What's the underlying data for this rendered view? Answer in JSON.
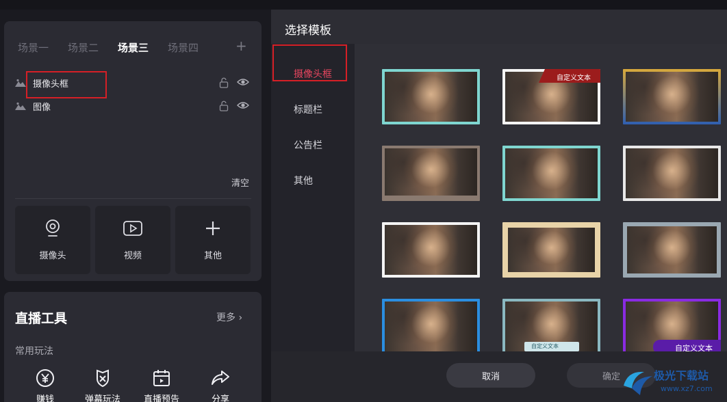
{
  "scenes": {
    "tabs": [
      "场景一",
      "场景二",
      "场景三",
      "场景四"
    ],
    "active_index": 2,
    "add_label": "+"
  },
  "layers": [
    {
      "name": "摄像头框"
    },
    {
      "name": "图像"
    }
  ],
  "clear_label": "清空",
  "sources": [
    {
      "label": "摄像头",
      "icon": "webcam-icon"
    },
    {
      "label": "视频",
      "icon": "video-icon"
    },
    {
      "label": "其他",
      "icon": "plus-icon"
    }
  ],
  "tools": {
    "title": "直播工具",
    "more_label": "更多",
    "subtitle": "常用玩法",
    "items": [
      {
        "label": "赚钱",
        "icon": "yen-coin-icon"
      },
      {
        "label": "弹幕玩法",
        "icon": "shield-cross-icon"
      },
      {
        "label": "直播预告",
        "icon": "calendar-icon"
      },
      {
        "label": "分享",
        "icon": "share-arrow-icon"
      }
    ]
  },
  "modal": {
    "title": "选择模板",
    "categories": [
      "摄像头框",
      "标题栏",
      "公告栏",
      "其他"
    ],
    "active_category": 0,
    "templates": [
      {
        "frame": "#7fd6d0",
        "style": "neon-cyan-yellow"
      },
      {
        "frame": "#ffffff",
        "style": "tag-red",
        "tag": "自定义文本"
      },
      {
        "frame": "#d8a93b",
        "style": "gold-blue"
      },
      {
        "frame": "#8a7a70",
        "style": "bronze-bottom"
      },
      {
        "frame": "#7fd6d0",
        "style": "teal-thin"
      },
      {
        "frame": "#ffffff",
        "style": "white-corner"
      },
      {
        "frame": "#ffffff",
        "style": "plain-white"
      },
      {
        "frame": "#e8d3a8",
        "style": "parchment"
      },
      {
        "frame": "#9aa8b2",
        "style": "steel"
      },
      {
        "frame": "#2b8ee0",
        "style": "blue-tech"
      },
      {
        "frame": "#8ab8c0",
        "style": "teal-caption",
        "tag": "自定义文本"
      },
      {
        "frame": "#8a2be2",
        "style": "purple",
        "tag": "自定义文本"
      }
    ],
    "cancel_label": "取消",
    "ok_label": "确定"
  },
  "watermark": {
    "name": "极光下载站",
    "url": "www.xz7.com"
  },
  "colors": {
    "accent_red": "#e8465f",
    "highlight_red": "#d61f26"
  }
}
